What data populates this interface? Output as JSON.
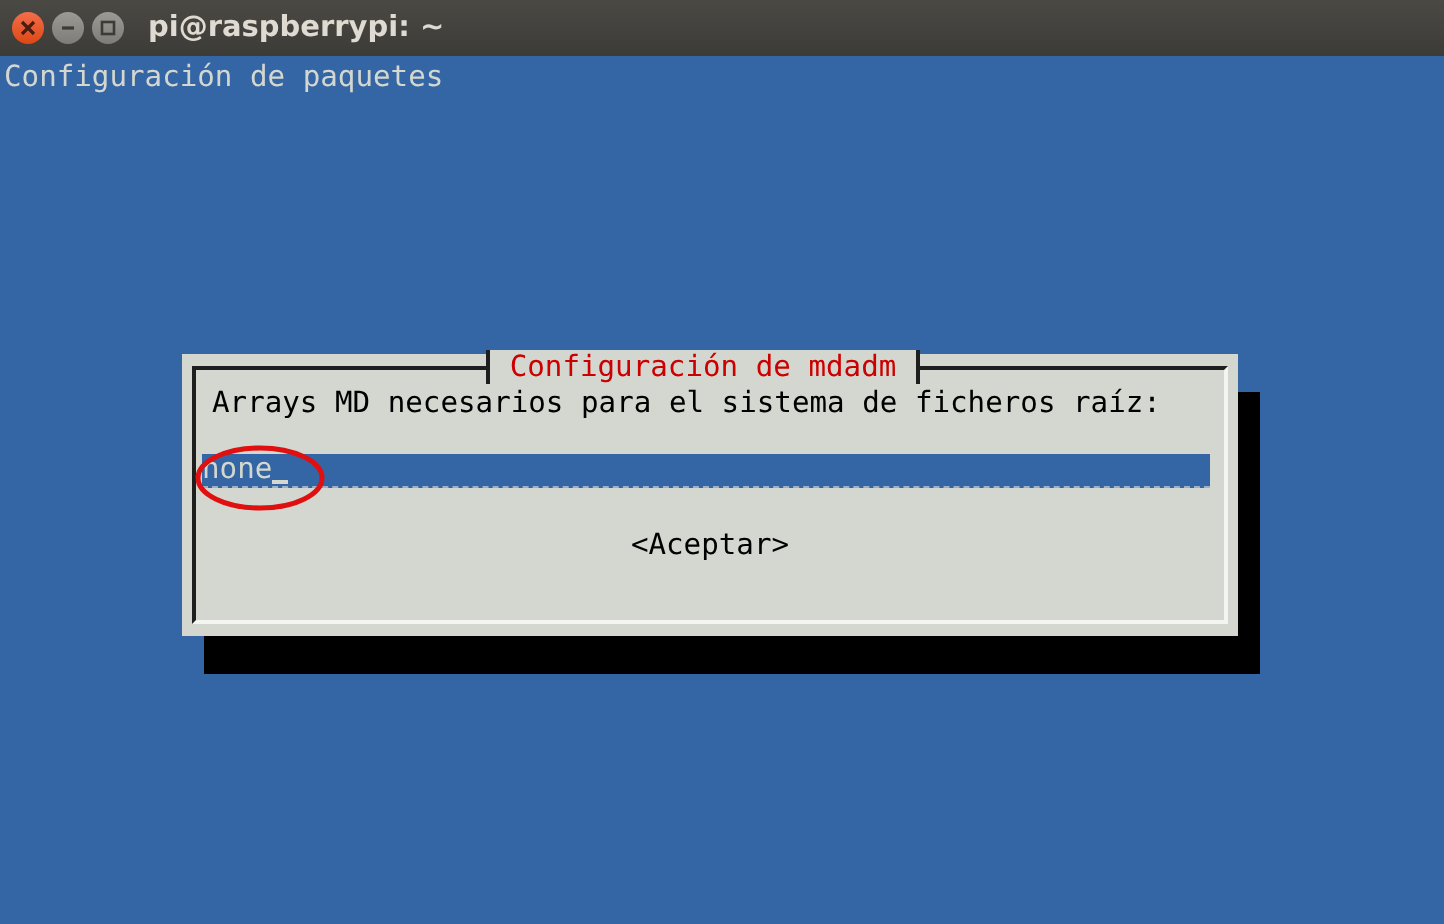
{
  "window": {
    "title": "pi@raspberrypi: ~"
  },
  "terminal": {
    "heading": "Configuración de paquetes"
  },
  "dialog": {
    "title": "Configuración de mdadm",
    "prompt": "Arrays MD necesarios para el sistema de ficheros raíz:",
    "field": {
      "value": "none",
      "focused": true
    },
    "buttons": [
      {
        "label": "<Aceptar>",
        "selected": false
      }
    ]
  }
}
